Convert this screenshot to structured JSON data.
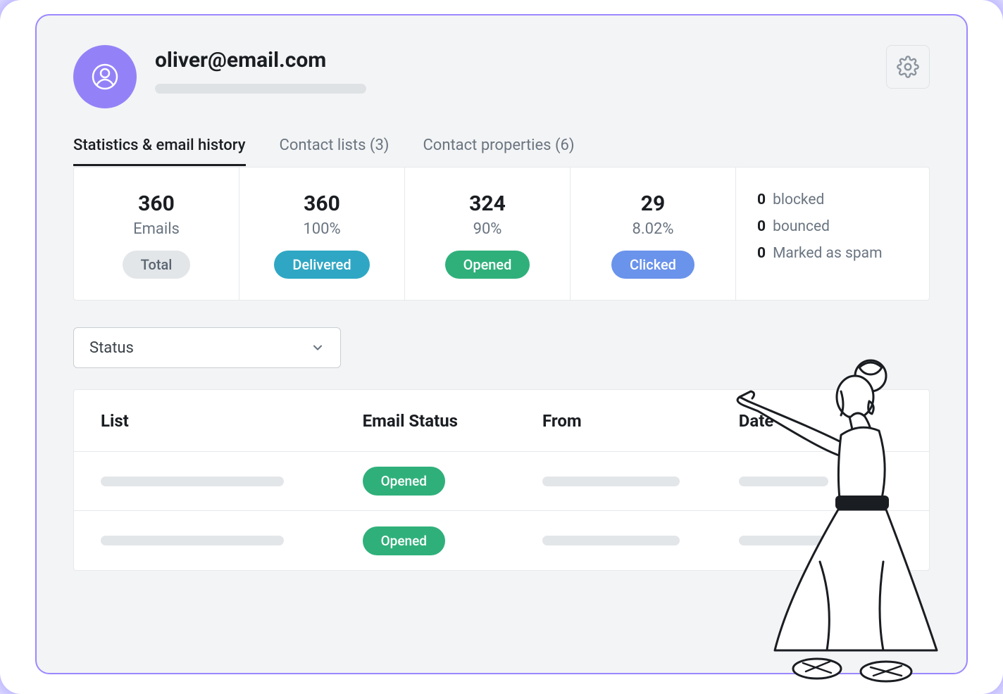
{
  "profile": {
    "email": "oliver@email.com"
  },
  "tabs": [
    {
      "label": "Statistics & email history",
      "active": true
    },
    {
      "label": "Contact lists (3)",
      "active": false
    },
    {
      "label": "Contact properties (6)",
      "active": false
    }
  ],
  "stats": {
    "total": {
      "value": "360",
      "sub": "Emails",
      "pill": "Total"
    },
    "delivered": {
      "value": "360",
      "sub": "100%",
      "pill": "Delivered"
    },
    "opened": {
      "value": "324",
      "sub": "90%",
      "pill": "Opened"
    },
    "clicked": {
      "value": "29",
      "sub": "8.02%",
      "pill": "Clicked"
    },
    "extra": {
      "blocked": {
        "n": "0",
        "label": "blocked"
      },
      "bounced": {
        "n": "0",
        "label": "bounced"
      },
      "spam": {
        "n": "0",
        "label": "Marked as spam"
      }
    }
  },
  "filter": {
    "label": "Status"
  },
  "table": {
    "headers": {
      "list": "List",
      "status": "Email Status",
      "from": "From",
      "date": "Date"
    },
    "rows": [
      {
        "status": "Opened"
      },
      {
        "status": "Opened"
      }
    ]
  }
}
